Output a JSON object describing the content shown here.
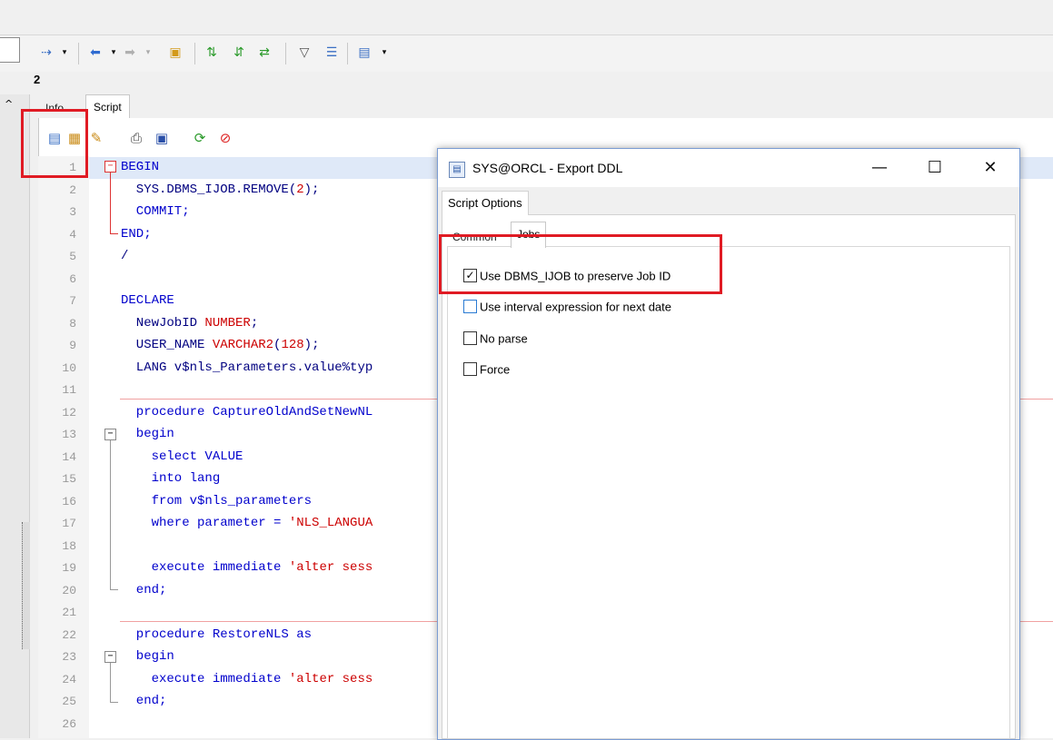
{
  "toolbar": {
    "icons": [
      "arrow-filter-icon",
      "back-icon",
      "forward-icon",
      "folder-icon",
      "refresh-icon",
      "tree-icon",
      "filter-icon",
      "list-icon",
      "window-icon"
    ]
  },
  "page_number": "2",
  "tabs": {
    "info": "Info",
    "script": "Script"
  },
  "editor": {
    "line_numbers": [
      "1",
      "2",
      "3",
      "4",
      "5",
      "6",
      "7",
      "8",
      "9",
      "10",
      "11",
      "12",
      "13",
      "14",
      "15",
      "16",
      "17",
      "18",
      "19",
      "20",
      "21",
      "22",
      "23",
      "24",
      "25",
      "26"
    ],
    "lines": {
      "l1": "BEGIN",
      "l2a": "  SYS.DBMS_IJOB.REMOVE(",
      "l2b": "2",
      "l2c": ");",
      "l3": "  COMMIT;",
      "l4": "END;",
      "l5": "/",
      "l7": "DECLARE",
      "l8a": "  NewJobID ",
      "l8b": "NUMBER",
      "l8c": ";",
      "l9a": "  USER_NAME ",
      "l9b": "VARCHAR2",
      "l9c": "(",
      "l9d": "128",
      "l9e": ");",
      "l10": "  LANG v$nls_Parameters.value%typ",
      "l12": "  procedure CaptureOldAndSetNewNL",
      "l13": "  begin",
      "l14": "    select VALUE",
      "l15": "    into lang",
      "l16": "    from v$nls_parameters",
      "l17a": "    where parameter = ",
      "l17b": "'NLS_LANGUA",
      "l19a": "    execute immediate ",
      "l19b": "'alter sess",
      "l20": "  end;",
      "l22": "  procedure RestoreNLS as",
      "l23": "  begin",
      "l24a": "    execute immediate ",
      "l24b": "'alter sess",
      "l25": "  end;"
    }
  },
  "dialog": {
    "title": "SYS@ORCL - Export DDL",
    "minimize": "—",
    "maximize": "☐",
    "close": "✕",
    "tab_script_options": "Script Options",
    "tab_common": "Common",
    "tab_jobs": "Jobs",
    "options": [
      {
        "label": "Use DBMS_IJOB to preserve Job ID",
        "checked": true
      },
      {
        "label": "Use interval expression for next date",
        "checked": false
      },
      {
        "label": "No parse",
        "checked": false
      },
      {
        "label": "Force",
        "checked": false
      }
    ]
  },
  "colors": {
    "highlight": "#e01b24",
    "keyword": "#0000cc",
    "literal": "#cc0000"
  }
}
